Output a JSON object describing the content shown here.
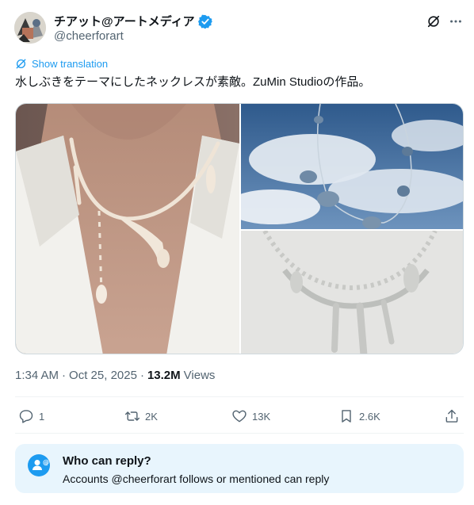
{
  "author": {
    "display_name": "チアット@アートメディア",
    "handle": "@cheerforart",
    "verified": true
  },
  "translate": {
    "label": "Show translation"
  },
  "tweet": {
    "text": "水しぶきをテーマにしたネックレスが素敵。ZuMin Studioの作品。"
  },
  "media": {
    "images": [
      {
        "name": "necklace-worn-photo"
      },
      {
        "name": "necklace-sky-photo"
      },
      {
        "name": "necklace-flatlay-photo"
      }
    ]
  },
  "meta": {
    "time": "1:34 AM",
    "separator": "·",
    "date": "Oct 25, 2025",
    "separator2": "·",
    "views_count": "13.2M",
    "views_label": "Views"
  },
  "actions": {
    "replies": "1",
    "reposts": "2K",
    "likes": "13K",
    "bookmarks": "2.6K"
  },
  "reply_restriction": {
    "title": "Who can reply?",
    "body": "Accounts @cheerforart follows or mentioned can reply"
  },
  "colors": {
    "accent": "#1d9bf0",
    "secondary_text": "#536471",
    "primary_text": "#0f1419",
    "reply_box_bg": "#e8f5fd"
  }
}
